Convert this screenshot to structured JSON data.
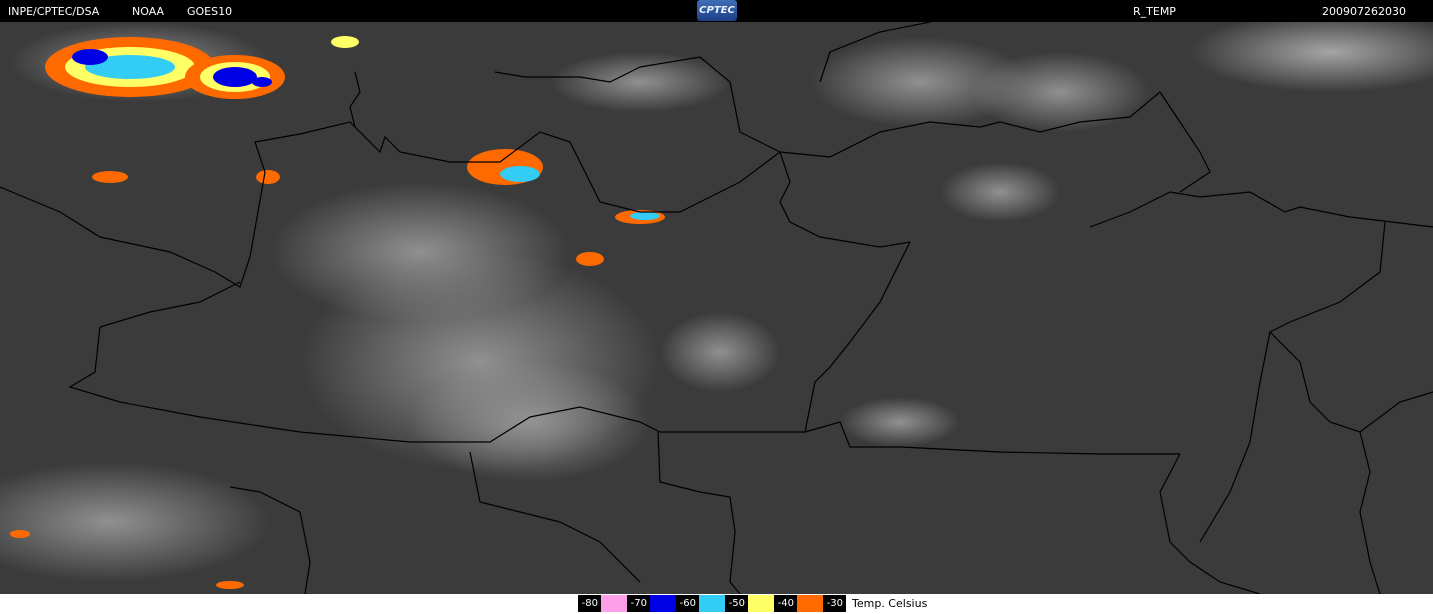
{
  "header": {
    "source": "INPE/CPTEC/DSA",
    "agency": "NOAA",
    "satellite": "GOES10",
    "logo_text": "CPTEC",
    "product": "R_TEMP",
    "timestamp": "200907262030"
  },
  "legend": {
    "items": [
      {
        "value": "-80",
        "color": "#ff9fe8"
      },
      {
        "value": "-70",
        "color": "#0000e6"
      },
      {
        "value": "-60",
        "color": "#33ccf5"
      },
      {
        "value": "-50",
        "color": "#ffff66"
      },
      {
        "value": "-40",
        "color": "#ff6a00"
      },
      {
        "value": "-30",
        "color": null
      }
    ],
    "unit": "Temp. Celsius"
  },
  "map": {
    "description_colors": {
      "background": "#3a3a3a",
      "borders": "#000000"
    }
  }
}
